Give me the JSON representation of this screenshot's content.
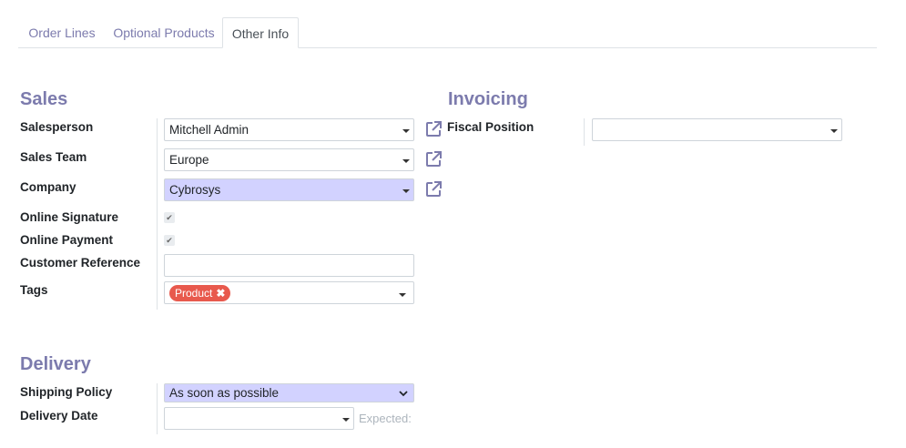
{
  "tabs": [
    {
      "label": "Order Lines",
      "active": false
    },
    {
      "label": "Optional Products",
      "active": false
    },
    {
      "label": "Other Info",
      "active": true
    }
  ],
  "sales": {
    "title": "Sales",
    "salesperson": {
      "label": "Salesperson",
      "value": "Mitchell Admin"
    },
    "sales_team": {
      "label": "Sales Team",
      "value": "Europe"
    },
    "company": {
      "label": "Company",
      "value": "Cybrosys"
    },
    "online_signature": {
      "label": "Online Signature",
      "checked": true
    },
    "online_payment": {
      "label": "Online Payment",
      "checked": true
    },
    "customer_reference": {
      "label": "Customer Reference",
      "value": ""
    },
    "tags": {
      "label": "Tags",
      "items": [
        "Product"
      ]
    }
  },
  "invoicing": {
    "title": "Invoicing",
    "fiscal_position": {
      "label": "Fiscal Position",
      "value": ""
    }
  },
  "delivery": {
    "title": "Delivery",
    "shipping_policy": {
      "label": "Shipping Policy",
      "value": "As soon as possible"
    },
    "delivery_date": {
      "label": "Delivery Date",
      "value": "",
      "expected_label": "Expected:"
    }
  },
  "colors": {
    "accent": "#7c7bad",
    "required_bg": "#d2d2ff",
    "tag_bg": "#e8594d"
  },
  "icons": [
    "external-link-icon",
    "caret-down-icon",
    "check-icon",
    "remove-icon",
    "chevron-down-icon"
  ]
}
